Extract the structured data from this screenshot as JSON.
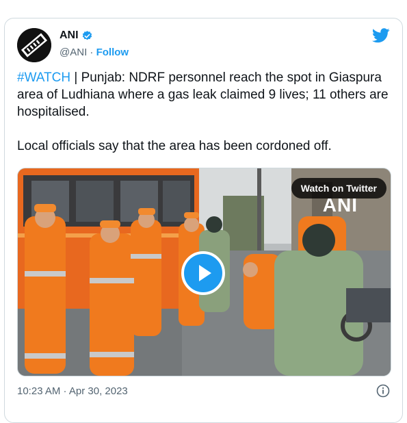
{
  "tweet": {
    "author_name": "ANI",
    "handle": "@ANI",
    "separator": " · ",
    "follow_label": "Follow",
    "hashtag": "#WATCH",
    "text_after_hashtag": " | Punjab: NDRF personnel reach the spot in Giaspura area of Ludhiana where a gas leak claimed 9 lives; 11 others are hospitalised.\n\nLocal officials say that the area has been cordoned off.",
    "timestamp": "10:23 AM · Apr 30, 2023"
  },
  "media": {
    "watch_label": "Watch on Twitter",
    "watermark": "ANI"
  },
  "icons": {
    "verified": "verified-badge-icon",
    "twitter": "twitter-bird-icon",
    "play": "play-icon",
    "info": "info-icon"
  },
  "colors": {
    "accent": "#1d9bf0",
    "muted": "#536471",
    "text": "#0f1419",
    "uniform": "#f07a1e"
  }
}
